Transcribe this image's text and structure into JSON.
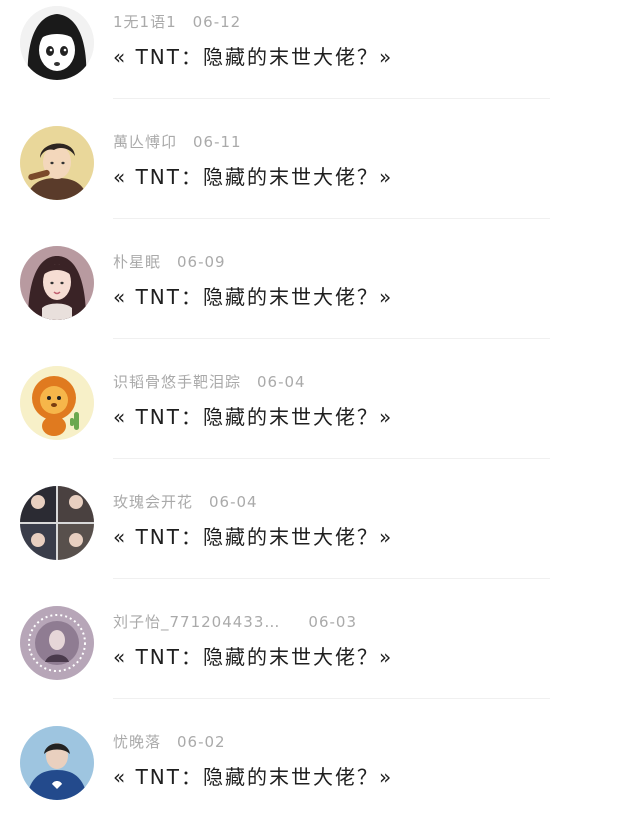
{
  "comments": [
    {
      "username": "1无1语1",
      "date": "06-12",
      "text": "« TNT：隐藏的末世大佬？»",
      "avatar": "manga-girl-avatar"
    },
    {
      "username": "萬亾愽卬",
      "date": "06-11",
      "text": "« TNT：隐藏的末世大佬？»",
      "avatar": "anime-boy-avatar"
    },
    {
      "username": "朴星眠",
      "date": "06-09",
      "text": "« TNT：隐藏的末世大佬？»",
      "avatar": "girl-portrait-avatar"
    },
    {
      "username": "识韬骨悠手靶泪踪",
      "date": "06-04",
      "text": "« TNT：隐藏的末世大佬？»",
      "avatar": "lion-cartoon-avatar"
    },
    {
      "username": "玫瑰会开花",
      "date": "06-04",
      "text": "« TNT：隐藏的末世大佬？»",
      "avatar": "photo-collage-avatar"
    },
    {
      "username": "刘子怡_771204433…",
      "date": "06-03",
      "text": "« TNT：隐藏的末世大佬？»",
      "avatar": "framed-photo-avatar"
    },
    {
      "username": "忧晚落",
      "date": "06-02",
      "text": "« TNT：隐藏的末世大佬？»",
      "avatar": "blue-hoodie-avatar"
    }
  ]
}
